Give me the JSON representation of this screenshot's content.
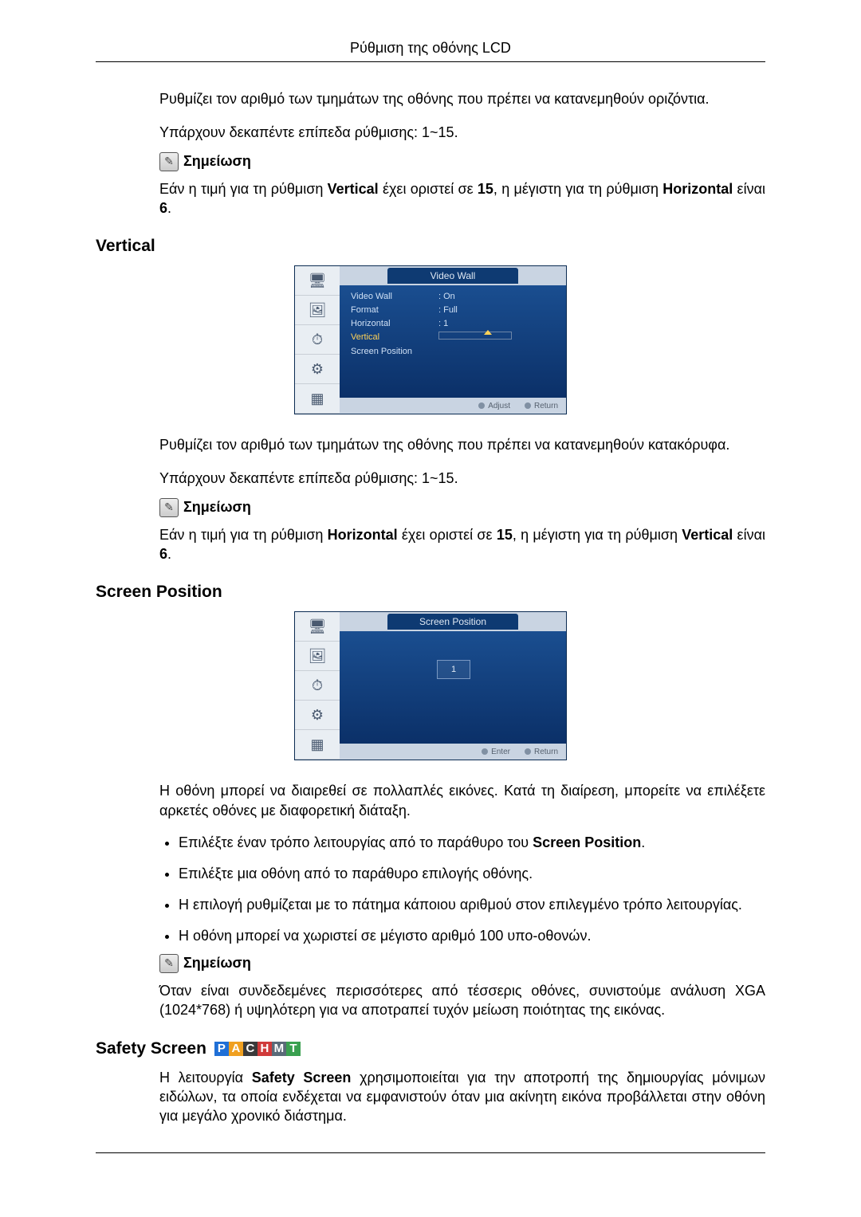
{
  "header": {
    "title": "Ρύθμιση της οθόνης LCD"
  },
  "intro_horizontal": {
    "p1": "Ρυθμίζει τον αριθμό των τμημάτων της οθόνης που πρέπει να κατανεμηθούν οριζόντια.",
    "p2": "Υπάρχουν δεκαπέντε επίπεδα ρύθμισης: 1~15.",
    "note_label": "Σημείωση",
    "note_text_a": "Εάν η τιμή για τη ρύθμιση ",
    "note_bold_a": "Vertical",
    "note_text_b": " έχει οριστεί σε ",
    "note_bold_b": "15",
    "note_text_c": ", η μέγιστη για τη ρύθμιση ",
    "note_bold_c": "Horizontal",
    "note_text_d": " είναι ",
    "note_bold_d": "6",
    "note_text_e": "."
  },
  "section_vertical": {
    "heading": "Vertical",
    "osd_title": "Video Wall",
    "rows": {
      "video_wall_k": "Video Wall",
      "video_wall_v": ": On",
      "format_k": "Format",
      "format_v": ": Full",
      "horiz_k": "Horizontal",
      "horiz_v": ": 1",
      "vert_k": "Vertical",
      "sp_k": "Screen Position"
    },
    "footer": {
      "adjust": "Adjust",
      "ret": "Return"
    },
    "p1": "Ρυθμίζει τον αριθμό των τμημάτων της οθόνης που πρέπει να κατανεμηθούν κατακόρυφα.",
    "p2": "Υπάρχουν δεκαπέντε επίπεδα ρύθμισης: 1~15.",
    "note_label": "Σημείωση",
    "note_text_a": "Εάν η τιμή για τη ρύθμιση ",
    "note_bold_a": "Horizontal",
    "note_text_b": " έχει οριστεί σε ",
    "note_bold_b": "15",
    "note_text_c": ", η μέγιστη για τη ρύθμιση ",
    "note_bold_c": "Vertical",
    "note_text_d": " είναι ",
    "note_bold_d": "6",
    "note_text_e": "."
  },
  "section_screen_position": {
    "heading": "Screen Position",
    "osd_title": "Screen Position",
    "grid_value": "1",
    "footer": {
      "enter": "Enter",
      "ret": "Return"
    },
    "p_intro": "Η οθόνη μπορεί να διαιρεθεί σε πολλαπλές εικόνες. Κατά τη διαίρεση, μπορείτε να επιλέξετε αρκετές οθόνες με διαφορετική διάταξη.",
    "b1_a": "Επιλέξτε έναν τρόπο λειτουργίας από το παράθυρο του ",
    "b1_b": "Screen Position",
    "b1_c": ".",
    "b2": "Επιλέξτε μια οθόνη από το παράθυρο επιλογής οθόνης.",
    "b3": "Η επιλογή ρυθμίζεται με το πάτημα κάποιου αριθμού στον επιλεγμένο τρόπο λειτουργίας.",
    "b4": "Η οθόνη μπορεί να χωριστεί σε μέγιστο αριθμό 100 υπο-οθονών.",
    "note_label": "Σημείωση",
    "note_text": "Όταν είναι συνδεδεμένες περισσότερες από τέσσερις οθόνες, συνιστούμε ανάλυση XGA (1024*768) ή υψηλότερη για να αποτραπεί τυχόν μείωση ποιότητας της εικόνας."
  },
  "section_safety": {
    "heading": "Safety Screen",
    "chips": {
      "P": {
        "t": "P",
        "c": "#1f6fd6"
      },
      "A": {
        "t": "A",
        "c": "#f0a020"
      },
      "C": {
        "t": "C",
        "c": "#3a3a3a"
      },
      "H": {
        "t": "H",
        "c": "#d03a3a"
      },
      "M": {
        "t": "M",
        "c": "#5a6a78"
      },
      "T": {
        "t": "T",
        "c": "#3aa050"
      }
    },
    "p_a": "Η λειτουργία ",
    "p_b": "Safety Screen",
    "p_c": " χρησιμοποιείται για την αποτροπή της δημιουργίας μόνιμων ειδώλων, τα οποία ενδέχεται να εμφανιστούν όταν μια ακίνητη εικόνα προβάλλεται στην οθόνη για μεγάλο χρονικό διάστημα."
  }
}
